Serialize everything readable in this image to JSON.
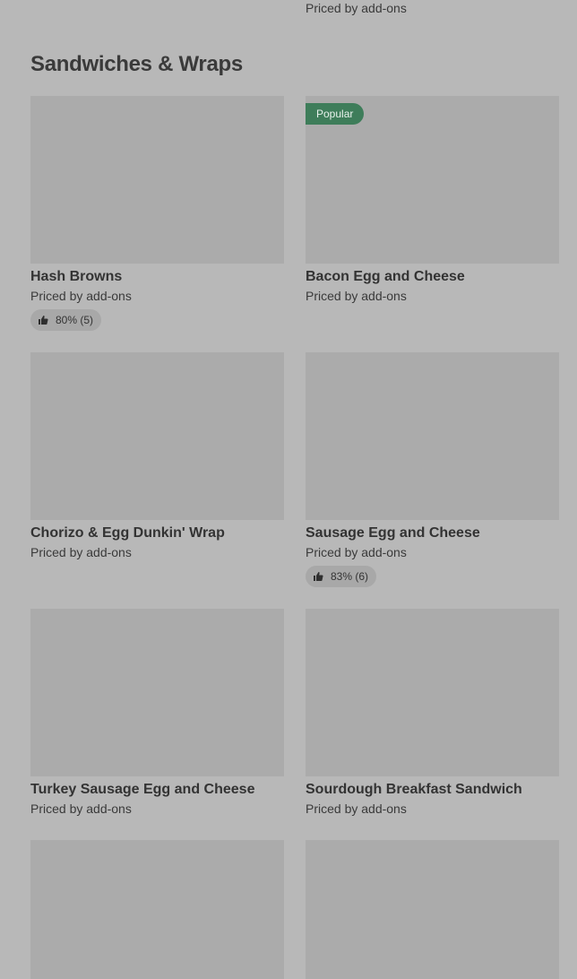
{
  "top_item": {
    "price": "Priced by add-ons"
  },
  "section": {
    "title": "Sandwiches & Wraps"
  },
  "items": [
    {
      "name": "Hash Browns",
      "price": "Priced by add-ons",
      "badge": "",
      "rating": "80% (5)"
    },
    {
      "name": "Bacon Egg and Cheese",
      "price": "Priced by add-ons",
      "badge": "Popular",
      "rating": ""
    },
    {
      "name": "Chorizo & Egg Dunkin' Wrap",
      "price": "Priced by add-ons",
      "badge": "",
      "rating": ""
    },
    {
      "name": "Sausage Egg and Cheese",
      "price": "Priced by add-ons",
      "badge": "",
      "rating": "83% (6)"
    },
    {
      "name": "Turkey Sausage Egg and Cheese",
      "price": "Priced by add-ons",
      "badge": "",
      "rating": ""
    },
    {
      "name": "Sourdough Breakfast Sandwich",
      "price": "Priced by add-ons",
      "badge": "",
      "rating": ""
    },
    {
      "name": "",
      "price": "",
      "badge": "",
      "rating": ""
    },
    {
      "name": "",
      "price": "",
      "badge": "",
      "rating": ""
    }
  ]
}
